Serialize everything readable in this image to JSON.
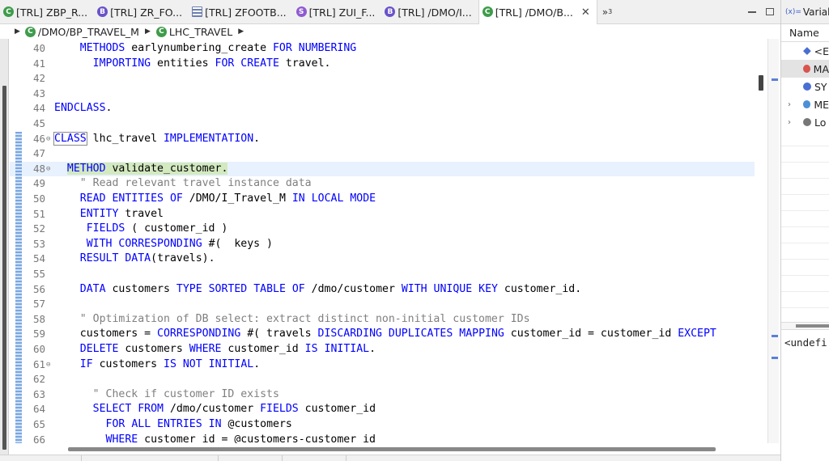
{
  "tabs": [
    {
      "label": "[TRL] ZBP_R...",
      "icon": "class-icon",
      "color": "#3e9c4b",
      "glyph": "C"
    },
    {
      "label": "[TRL] ZR_FO...",
      "icon": "behavior-icon",
      "color": "#6a52c9",
      "glyph": "B"
    },
    {
      "label": "[TRL] ZFOOTB...",
      "icon": "table-icon",
      "color": "#6b7fae",
      "glyph": ""
    },
    {
      "label": "[TRL] ZUI_F...",
      "icon": "service-icon",
      "color": "#8f5ad1",
      "glyph": "S"
    },
    {
      "label": "[TRL] /DMO/I...",
      "icon": "behavior-icon",
      "color": "#6a52c9",
      "glyph": "B"
    },
    {
      "label": "[TRL] /DMO/B...",
      "icon": "class-icon",
      "color": "#3e9c4b",
      "glyph": "C",
      "active": true
    }
  ],
  "tab_overflow": "»",
  "tab_overflow_count": "3",
  "breadcrumb": {
    "class": "/DMO/BP_TRAVEL_M",
    "local_class": "LHC_TRAVEL"
  },
  "variables": {
    "tab": "Variab",
    "column_name": "Name",
    "rows": [
      {
        "name": "<E",
        "color": "#4a6fd1"
      },
      {
        "name": "MA",
        "color": "#d9534f",
        "selected": true
      },
      {
        "name": "SY",
        "color": "#4a6fd1"
      },
      {
        "name": "ME",
        "color": "#4a8fd8"
      },
      {
        "name": "Lo",
        "color": "#777777"
      }
    ],
    "detail": "<undefi"
  },
  "code": [
    {
      "n": "40",
      "t": "    METHODS earlynumbering_create FOR NUMBERING"
    },
    {
      "n": "41",
      "t": "      IMPORTING entities FOR CREATE travel."
    },
    {
      "n": "42",
      "t": ""
    },
    {
      "n": "43",
      "t": ""
    },
    {
      "n": "44",
      "t": "ENDCLASS."
    },
    {
      "n": "45",
      "t": ""
    },
    {
      "n": "46",
      "t": "CLASS lhc_travel IMPLEMENTATION."
    },
    {
      "n": "47",
      "t": ""
    },
    {
      "n": "48",
      "t": "  METHOD validate_customer."
    },
    {
      "n": "49",
      "t": "    \" Read relevant travel instance data"
    },
    {
      "n": "50",
      "t": "    READ ENTITIES OF /DMO/I_Travel_M IN LOCAL MODE"
    },
    {
      "n": "51",
      "t": "    ENTITY travel"
    },
    {
      "n": "52",
      "t": "     FIELDS ( customer_id )"
    },
    {
      "n": "53",
      "t": "     WITH CORRESPONDING #(  keys )"
    },
    {
      "n": "54",
      "t": "    RESULT DATA(travels)."
    },
    {
      "n": "55",
      "t": ""
    },
    {
      "n": "56",
      "t": "    DATA customers TYPE SORTED TABLE OF /dmo/customer WITH UNIQUE KEY customer_id."
    },
    {
      "n": "57",
      "t": ""
    },
    {
      "n": "58",
      "t": "    \" Optimization of DB select: extract distinct non-initial customer IDs"
    },
    {
      "n": "59",
      "t": "    customers = CORRESPONDING #( travels DISCARDING DUPLICATES MAPPING customer_id = customer_id EXCEPT"
    },
    {
      "n": "60",
      "t": "    DELETE customers WHERE customer_id IS INITIAL."
    },
    {
      "n": "61",
      "t": "    IF customers IS NOT INITIAL."
    },
    {
      "n": "62",
      "t": ""
    },
    {
      "n": "63",
      "t": "      \" Check if customer ID exists"
    },
    {
      "n": "64",
      "t": "      SELECT FROM /dmo/customer FIELDS customer_id"
    },
    {
      "n": "65",
      "t": "        FOR ALL ENTRIES IN @customers"
    },
    {
      "n": "66",
      "t": "        WHERE customer_id = @customers-customer_id"
    }
  ]
}
